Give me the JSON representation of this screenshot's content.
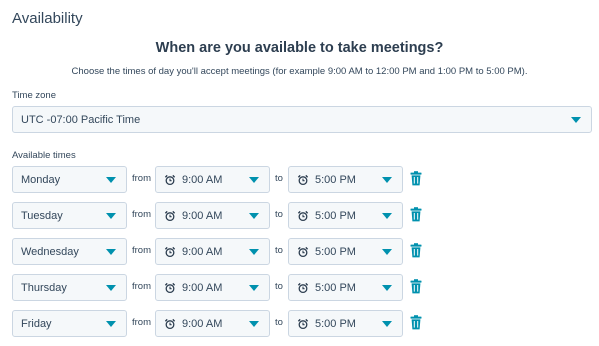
{
  "section_title": "Availability",
  "heading": "When are you available to take meetings?",
  "subtext": "Choose the times of day you'll accept meetings (for example 9:00 AM to 12:00 PM and 1:00 PM to 5:00 PM).",
  "timezone": {
    "label": "Time zone",
    "value": "UTC -07:00 Pacific Time"
  },
  "available_times": {
    "label": "Available times",
    "from_label": "from",
    "to_label": "to",
    "rows": [
      {
        "day": "Monday",
        "start": "9:00 AM",
        "end": "5:00 PM"
      },
      {
        "day": "Tuesday",
        "start": "9:00 AM",
        "end": "5:00 PM"
      },
      {
        "day": "Wednesday",
        "start": "9:00 AM",
        "end": "5:00 PM"
      },
      {
        "day": "Thursday",
        "start": "9:00 AM",
        "end": "5:00 PM"
      },
      {
        "day": "Friday",
        "start": "9:00 AM",
        "end": "5:00 PM"
      }
    ]
  },
  "icons": {
    "dropdown": "chevron-down-icon",
    "time": "alarm-clock-icon",
    "delete": "trash-icon"
  },
  "colors": {
    "accent": "#0091ae",
    "text": "#33475b",
    "field_bg": "#f5f8fa",
    "border": "#cbd6e2"
  }
}
